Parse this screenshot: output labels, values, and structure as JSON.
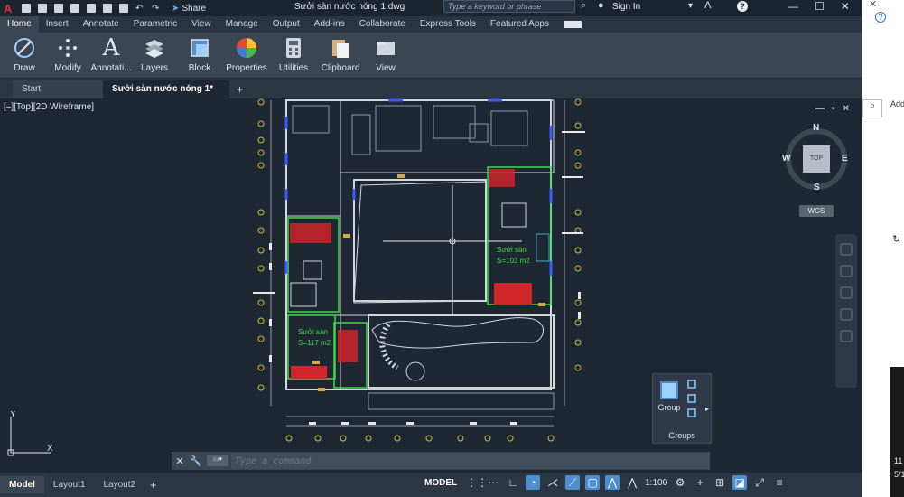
{
  "titlebar": {
    "app_icon": "A",
    "share_label": "Share",
    "doc_title": "Sưởi sàn nước nóng 1.dwg",
    "search_placeholder": "Type a keyword or phrase",
    "signin_label": "Sign In"
  },
  "ribbon_tabs": [
    "Home",
    "Insert",
    "Annotate",
    "Parametric",
    "View",
    "Manage",
    "Output",
    "Add-ins",
    "Collaborate",
    "Express Tools",
    "Featured Apps"
  ],
  "ribbon_buttons": [
    {
      "label": "Draw",
      "icon": "draw-icon"
    },
    {
      "label": "Modify",
      "icon": "modify-icon"
    },
    {
      "label": "Annotati...",
      "icon": "annotation-icon"
    },
    {
      "label": "Layers",
      "icon": "layers-icon"
    },
    {
      "label": "Block",
      "icon": "block-icon"
    },
    {
      "label": "Properties",
      "icon": "properties-icon"
    },
    {
      "label": "Utilities",
      "icon": "utilities-icon"
    },
    {
      "label": "Clipboard",
      "icon": "clipboard-icon"
    },
    {
      "label": "View",
      "icon": "view-icon"
    }
  ],
  "doc_tabs": {
    "start": "Start",
    "active": "Sưởi sàn nước nóng 1*"
  },
  "viewport": {
    "label": "[–][Top][2D Wireframe]",
    "viewcube": {
      "n": "N",
      "s": "S",
      "e": "E",
      "w": "W",
      "top": "TOP"
    },
    "wcs": "WCS"
  },
  "drawing_labels": {
    "room_a": "Sưởi sàn",
    "room_a_area": "S=103 m2",
    "room_b": "Sưởi sàn",
    "room_b_area": "S=117 m2"
  },
  "groups_panel": {
    "button_label": "Group",
    "title": "Groups"
  },
  "command_line": {
    "placeholder": "Type a command"
  },
  "statusbar": {
    "tabs": [
      "Model",
      "Layout1",
      "Layout2"
    ],
    "model_label": "MODEL",
    "scale": "1:100"
  },
  "right_strip": {
    "add_label": "Add",
    "time": "11",
    "date": "5/1"
  }
}
